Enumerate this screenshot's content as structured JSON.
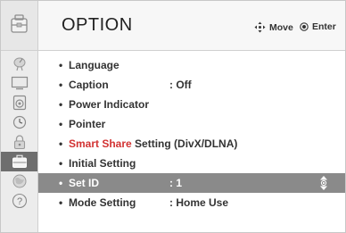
{
  "header": {
    "title": "OPTION",
    "move_label": "Move",
    "enter_label": "Enter"
  },
  "sidebar": {
    "icons": [
      "satellite-dish-icon",
      "monitor-icon",
      "speaker-icon",
      "clock-icon",
      "padlock-icon",
      "toolbox-icon",
      "globe-icon",
      "help-icon"
    ],
    "active_index": 5,
    "help_glyph": "?"
  },
  "menu": {
    "bullet": "•",
    "items": [
      {
        "label": "Language",
        "value": ""
      },
      {
        "label": "Caption",
        "value": ": Off"
      },
      {
        "label": "Power Indicator",
        "value": ""
      },
      {
        "label": "Pointer",
        "value": ""
      },
      {
        "label_highlight": "Smart Share",
        "label": " Setting (DivX/DLNA)",
        "value": ""
      },
      {
        "label": "Initial Setting",
        "value": ""
      },
      {
        "label": "Set ID",
        "value": ": 1",
        "selected": true
      },
      {
        "label": "Mode Setting",
        "value": ": Home Use"
      }
    ]
  },
  "colors": {
    "accent": "#d23232",
    "selected_row": "#8a8a8a",
    "active_sidebar": "#6e6e6e"
  }
}
